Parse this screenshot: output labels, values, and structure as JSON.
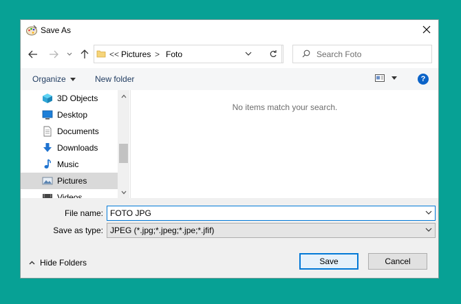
{
  "window": {
    "title": "Save As"
  },
  "address": {
    "overflow_marker": "<<",
    "crumbs": [
      "Pictures",
      "Foto"
    ],
    "separator": ">"
  },
  "search": {
    "placeholder": "Search Foto"
  },
  "toolbar": {
    "organize_label": "Organize",
    "new_folder_label": "New folder",
    "help_label": "?"
  },
  "navpane": {
    "items": [
      {
        "label": "3D Objects",
        "icon": "cube-icon"
      },
      {
        "label": "Desktop",
        "icon": "desktop-icon"
      },
      {
        "label": "Documents",
        "icon": "document-icon"
      },
      {
        "label": "Downloads",
        "icon": "download-arrow-icon"
      },
      {
        "label": "Music",
        "icon": "music-note-icon"
      },
      {
        "label": "Pictures",
        "icon": "pictures-icon",
        "selected": true
      },
      {
        "label": "Videos",
        "icon": "video-icon"
      }
    ]
  },
  "content": {
    "empty_message": "No items match your search."
  },
  "form": {
    "file_name_label": "File name:",
    "file_name_value": "FOTO JPG",
    "save_type_label": "Save as type:",
    "save_type_value": "JPEG (*.jpg;*.jpeg;*.jpe;*.jfif)"
  },
  "footer": {
    "hide_folders_label": "Hide Folders",
    "save_label": "Save",
    "cancel_label": "Cancel"
  },
  "colors": {
    "desktop_bg": "#07a195",
    "accent": "#0078d7",
    "selected_bg": "#d9d9d9"
  }
}
